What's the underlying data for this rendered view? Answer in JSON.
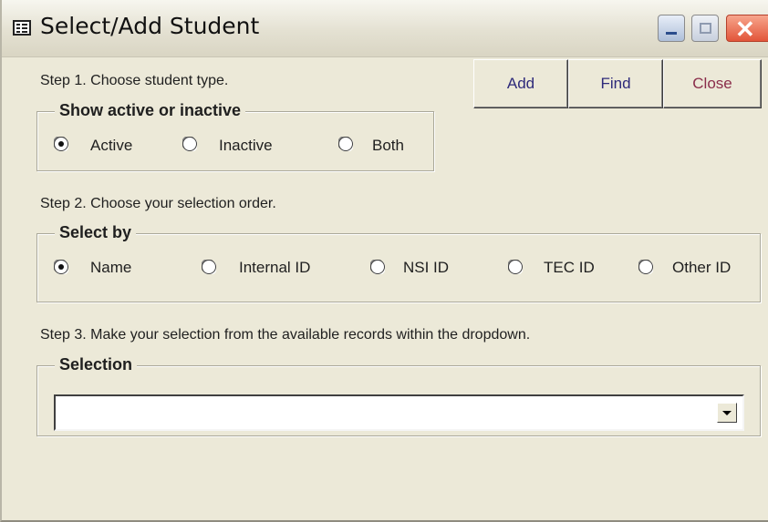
{
  "window": {
    "title": "Select/Add Student",
    "icon": "form-icon",
    "controls": [
      "minimize-icon",
      "maximize-icon",
      "close-icon"
    ]
  },
  "buttons": {
    "add": "Add",
    "find": "Find",
    "close": "Close",
    "add_color": "#2e2a7a",
    "find_color": "#2e2a7a",
    "close_color": "#8a2d4a"
  },
  "step1": {
    "text": "Step 1. Choose student type.",
    "group_label": "Show active or inactive",
    "options": [
      "Active",
      "Inactive",
      "Both"
    ],
    "selected": "Active"
  },
  "step2": {
    "text": "Step 2. Choose your selection order.",
    "group_label": "Select by",
    "options": [
      "Name",
      "Internal ID",
      "NSI ID",
      "TEC ID",
      "Other ID"
    ],
    "selected": "Name"
  },
  "step3": {
    "text": "Step 3. Make your selection from the available records within the dropdown.",
    "group_label": "Selection",
    "dropdown_value": ""
  }
}
